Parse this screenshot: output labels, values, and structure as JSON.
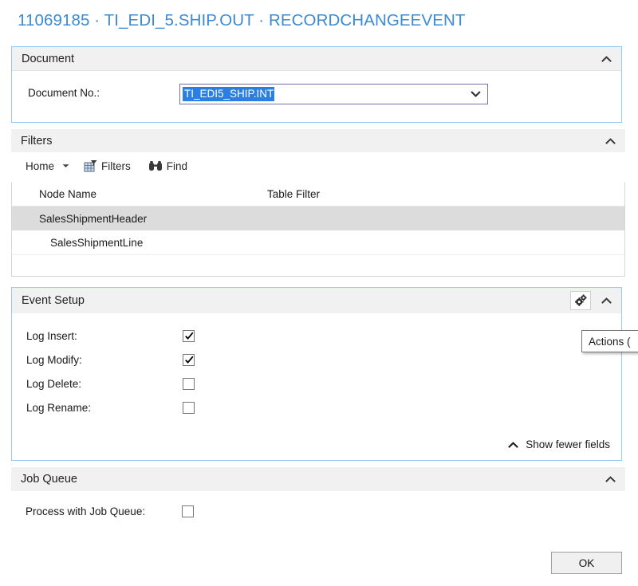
{
  "page": {
    "title": "11069185 · TI_EDI_5.SHIP.OUT · RECORDCHANGEEVENT"
  },
  "document_section": {
    "header": "Document",
    "collapse_icon": "chevron-up-icon",
    "field_label": "Document No.:",
    "field_value": "TI_EDI5_SHIP.INT",
    "dropdown_icon": "chevron-down-icon"
  },
  "filters_section": {
    "header": "Filters",
    "collapse_icon": "chevron-up-icon",
    "toolbar": {
      "home_label": "Home",
      "home_caret_icon": "caret-down-icon",
      "filters_label": "Filters",
      "filters_icon": "filter-grid-icon",
      "find_label": "Find",
      "find_icon": "binoculars-icon"
    },
    "grid": {
      "columns": [
        "Node Name",
        "Table Filter"
      ],
      "rows": [
        {
          "node_name": "SalesShipmentHeader",
          "table_filter": "",
          "selected": true,
          "indent": false
        },
        {
          "node_name": "SalesShipmentLine",
          "table_filter": "",
          "selected": false,
          "indent": true
        },
        {
          "node_name": "",
          "table_filter": "",
          "selected": false,
          "indent": false
        }
      ]
    }
  },
  "event_setup_section": {
    "header": "Event Setup",
    "actions_icon": "gears-icon",
    "collapse_icon": "chevron-up-icon",
    "fields": [
      {
        "label": "Log Insert:",
        "checked": true
      },
      {
        "label": "Log Modify:",
        "checked": true
      },
      {
        "label": "Log Delete:",
        "checked": false
      },
      {
        "label": "Log Rename:",
        "checked": false
      }
    ],
    "show_fewer_label": "Show fewer fields",
    "show_fewer_icon": "chevron-up-icon",
    "tooltip_text": "Actions ("
  },
  "job_queue_section": {
    "header": "Job Queue",
    "collapse_icon": "chevron-up-icon",
    "field_label": "Process with Job Queue:",
    "checked": false
  },
  "footer": {
    "ok_label": "OK"
  },
  "colors": {
    "title_blue": "#3a8ad4",
    "panel_header_bg": "#f1f1f1",
    "focus_border": "#9cc7ef",
    "selection_blue": "#2a7fe0",
    "row_selected": "#dcdcdc"
  }
}
